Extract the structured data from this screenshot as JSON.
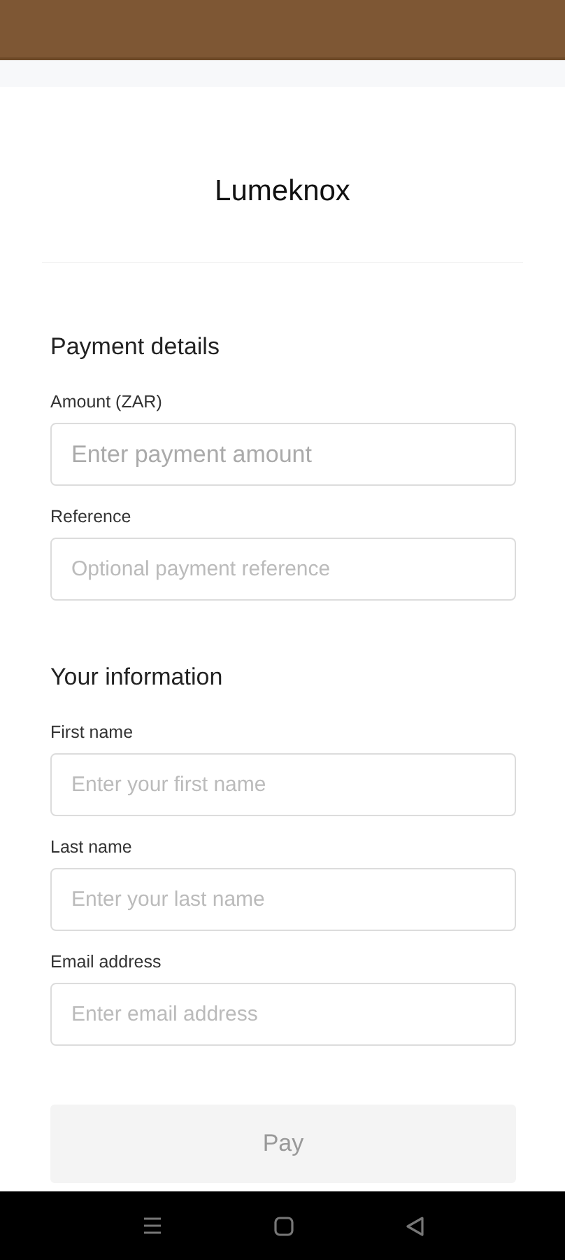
{
  "header": {
    "title": "Lumeknox"
  },
  "sections": [
    {
      "title": "Payment details",
      "fields": [
        {
          "label": "Amount (ZAR)",
          "placeholder": "Enter payment amount",
          "kind": "large"
        },
        {
          "label": "Reference",
          "placeholder": "Optional payment reference",
          "kind": "small"
        }
      ]
    },
    {
      "title": "Your information",
      "fields": [
        {
          "label": "First name",
          "placeholder": "Enter your first name",
          "kind": "small"
        },
        {
          "label": "Last name",
          "placeholder": "Enter your last name",
          "kind": "small"
        },
        {
          "label": "Email address",
          "placeholder": "Enter email address",
          "kind": "small"
        }
      ]
    }
  ],
  "pay_button": {
    "label": "Pay",
    "disabled": true
  }
}
